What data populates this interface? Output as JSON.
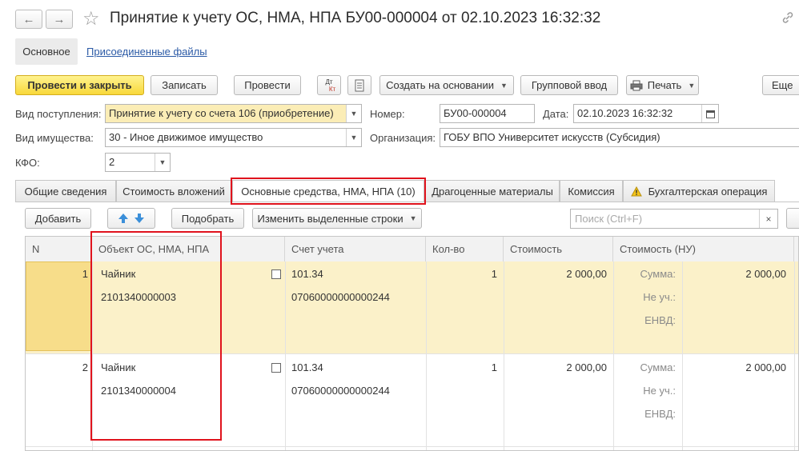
{
  "window": {
    "title": "Принятие к учету ОС, НМА, НПА БУ00-000004 от 02.10.2023 16:32:32",
    "back_icon": "←",
    "forward_icon": "→",
    "star_icon": "☆",
    "link_icon": "🔗"
  },
  "subtabs": {
    "main": "Основное",
    "files": "Присоединенные файлы"
  },
  "toolbar": {
    "post_close": "Провести и закрыть",
    "save": "Записать",
    "post": "Провести",
    "dtkt_top": "Дт",
    "dtkt_bottom": "Кт",
    "create_based": "Создать на основании",
    "group_input": "Групповой ввод",
    "print": "Печать",
    "more": "Еще"
  },
  "form": {
    "receipt_type_label": "Вид поступления:",
    "receipt_type_value": "Принятие к учету со счета 106 (приобретение)",
    "property_type_label": "Вид имущества:",
    "property_type_value": "30 - Иное движимое имущество",
    "kfo_label": "КФО:",
    "kfo_value": "2",
    "number_label": "Номер:",
    "number_value": "БУ00-000004",
    "date_label": "Дата:",
    "date_value": "02.10.2023 16:32:32",
    "org_label": "Организация:",
    "org_value": "ГОБУ ВПО Университет искусств (Субсидия)"
  },
  "tabs": [
    "Общие сведения",
    "Стоимость вложений",
    "Основные средства, НМА, НПА (10)",
    "Драгоценные материалы",
    "Комиссия",
    "Бухгалтерская операция"
  ],
  "table_toolbar": {
    "add": "Добавить",
    "select": "Подобрать",
    "change_rows": "Изменить выделенные строки",
    "search_placeholder": "Поиск (Ctrl+F)",
    "clear": "×"
  },
  "table": {
    "columns": [
      "N",
      "Объект ОС, НМА, НПА",
      "Счет учета",
      "Кол-во",
      "Стоимость",
      "Стоимость (НУ)"
    ],
    "sub_labels": [
      "Сумма:",
      "Не уч.:",
      "ЕНВД:"
    ],
    "rows": [
      {
        "n": "1",
        "object": "Чайник",
        "inv": "2101340000003",
        "account": "101.34",
        "account_code": "07060000000000244",
        "qty": "1",
        "cost": "2 000,00",
        "nu_sum": "2 000,00"
      },
      {
        "n": "2",
        "object": "Чайник",
        "inv": "2101340000004",
        "account": "101.34",
        "account_code": "07060000000000244",
        "qty": "1",
        "cost": "2 000,00",
        "nu_sum": "2 000,00"
      }
    ]
  },
  "colors": {
    "highlight_row": "#fbf1c9",
    "selected_cell": "#f7dd8a",
    "accent_red": "#e0131d",
    "primary_button": "#f8d83a",
    "link": "#2b5aa6"
  }
}
